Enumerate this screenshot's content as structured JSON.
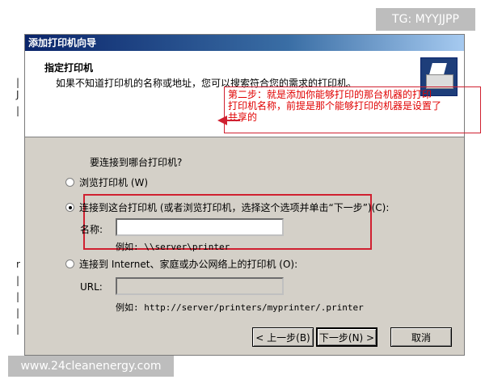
{
  "window": {
    "title": "添加打印机向导"
  },
  "header": {
    "title": "指定打印机",
    "subtitle": "如果不知道打印机的名称或地址，您可以搜索符合您的需求的打印机。"
  },
  "annotation": {
    "line1": "第二步：就是添加你能够打印的那台机器的打印",
    "line2": "打印机名称，前提是那个能够打印的机器是设置了",
    "line3": "共享的"
  },
  "form": {
    "question": "要连接到哪台打印机?",
    "option_browse": "浏览打印机 (W)",
    "option_connect": "连接到这台打印机 (或者浏览打印机，选择这个选项并单击“下一步”)(C):",
    "name_label": "名称:",
    "name_value": "",
    "name_example": "例如: \\\\server\\printer",
    "option_internet": "连接到 Internet、家庭或办公网络上的打印机 (O):",
    "url_label": "URL:",
    "url_value": "",
    "url_example": "例如: http://server/printers/myprinter/.printer"
  },
  "buttons": {
    "back": "< 上一步(B)",
    "next": "下一步(N) >",
    "cancel": "取消"
  },
  "watermarks": {
    "top": "TG: MYYJJPP",
    "bottom": "www.24cleanenergy.com"
  }
}
